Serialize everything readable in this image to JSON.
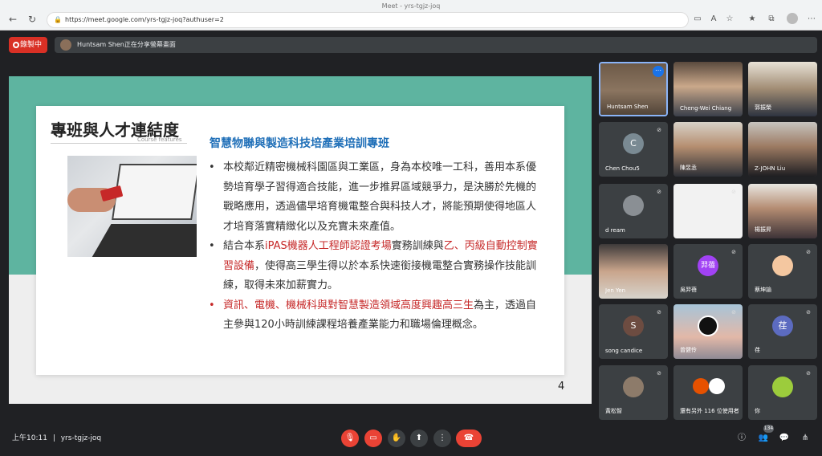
{
  "browser": {
    "tab_title": "Meet - yrs-tgjz-joq",
    "url": "https://meet.google.com/yrs-tgjz-joq?authuser=2"
  },
  "meet": {
    "recording_label": "錄製中",
    "presenting_banner": "Huntsam Shen正在分享螢幕畫面"
  },
  "slide": {
    "title": "專班與人才連結度",
    "subtitle": "Course features",
    "heading": "智慧物聯與製造科技培產業培訓專班",
    "bullet1": "本校鄰近精密機械科園區與工業區，身為本校唯一工科，善用本系優勢培育學子習得適合技能，進一步推昇區域競爭力，是決勝於先機的戰略應用，透過儘早培育機電整合與科技人才，將能預期使得地區人才培育落實精緻化以及充實未來產值。",
    "bullet2_a": "結合本系",
    "bullet2_red1": "iPAS機器人工程師認證考場",
    "bullet2_b": "實務訓練與",
    "bullet2_red2": "乙、丙級自動控制實習設備",
    "bullet2_c": "，使得高三學生得以於本系快速銜接機電整合實務操作技能訓練，取得未來加薪實力。",
    "bullet3_red": "資訊、電機、機械科與對智慧製造領域高度興趣高三生",
    "bullet3_b": "為主，透過自主參與120小時訓練課程培養產業能力和職場倫理概念。",
    "page_number": "4"
  },
  "participants": [
    {
      "name": "Huntsam Shen"
    },
    {
      "name": "Cheng-Wei Chiang"
    },
    {
      "name": "郭振榮"
    },
    {
      "name": "Chen Chou5",
      "initial": "C"
    },
    {
      "name": "陳昱丞"
    },
    {
      "name": "Z-JOHN Liu"
    },
    {
      "name": "d ream"
    },
    {
      "name": ""
    },
    {
      "name": "楊振昇"
    },
    {
      "name": "Jen Yen"
    },
    {
      "name": "吳羿蓓",
      "initial": "羿蓓"
    },
    {
      "name": "蔡坤諭"
    },
    {
      "name": "song candice",
      "initial": "S"
    },
    {
      "name": "曾健伶"
    },
    {
      "name": "荏",
      "initial": "荏"
    },
    {
      "name": "黃松智"
    },
    {
      "name": "還有另外 116 位使用者"
    },
    {
      "name": "你"
    }
  ],
  "bottom": {
    "time": "上午10:11",
    "separator": "|",
    "meeting_code": "yrs-tgjz-joq",
    "people_count": "134"
  },
  "colors": {
    "accent_blue": "#1f6fb8",
    "accent_red": "#c62828",
    "slide_band": "#5eb4a0",
    "meet_bg": "#202124"
  }
}
